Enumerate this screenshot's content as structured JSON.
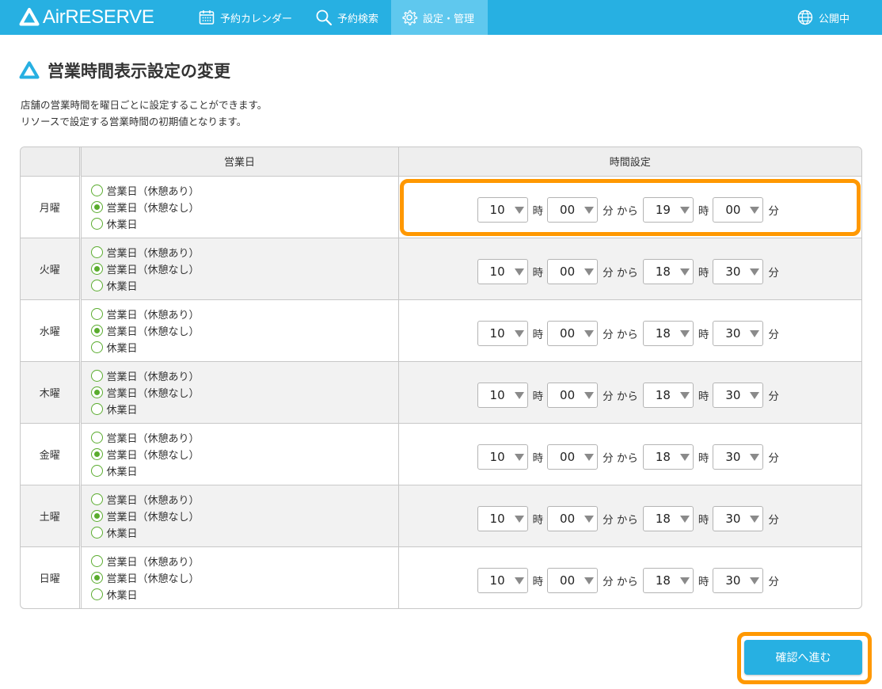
{
  "header": {
    "logo_text": "AirRESERVE",
    "nav": [
      {
        "label": "予約カレンダー",
        "icon": "calendar-icon"
      },
      {
        "label": "予約検索",
        "icon": "search-icon"
      },
      {
        "label": "設定・管理",
        "icon": "gear-icon",
        "active": true
      },
      {
        "label": "公開中",
        "icon": "globe-icon"
      }
    ]
  },
  "page": {
    "title": "営業時間表示設定の変更",
    "description_1": "店舗の営業時間を曜日ごとに設定することができます。",
    "description_2": "リソースで設定する営業時間の初期値となります。"
  },
  "table": {
    "headers": {
      "day": "",
      "business_day": "営業日",
      "time_setting": "時間設定"
    },
    "radio_options": [
      "営業日（休憩あり）",
      "営業日（休憩なし）",
      "休業日"
    ],
    "units": {
      "hour": "時",
      "minute_from": "分 から",
      "minute": "分"
    },
    "rows": [
      {
        "day": "月曜",
        "selected": 1,
        "start_hour": "10",
        "start_min": "00",
        "end_hour": "19",
        "end_min": "00"
      },
      {
        "day": "火曜",
        "selected": 1,
        "start_hour": "10",
        "start_min": "00",
        "end_hour": "18",
        "end_min": "30"
      },
      {
        "day": "水曜",
        "selected": 1,
        "start_hour": "10",
        "start_min": "00",
        "end_hour": "18",
        "end_min": "30"
      },
      {
        "day": "木曜",
        "selected": 1,
        "start_hour": "10",
        "start_min": "00",
        "end_hour": "18",
        "end_min": "30"
      },
      {
        "day": "金曜",
        "selected": 1,
        "start_hour": "10",
        "start_min": "00",
        "end_hour": "18",
        "end_min": "30"
      },
      {
        "day": "土曜",
        "selected": 1,
        "start_hour": "10",
        "start_min": "00",
        "end_hour": "18",
        "end_min": "30"
      },
      {
        "day": "日曜",
        "selected": 1,
        "start_hour": "10",
        "start_min": "00",
        "end_hour": "18",
        "end_min": "30"
      }
    ]
  },
  "footer": {
    "confirm_label": "確認へ進む"
  },
  "colors": {
    "brand": "#27b0e2",
    "highlight": "#ff9800",
    "radio": "#5aac2e"
  }
}
